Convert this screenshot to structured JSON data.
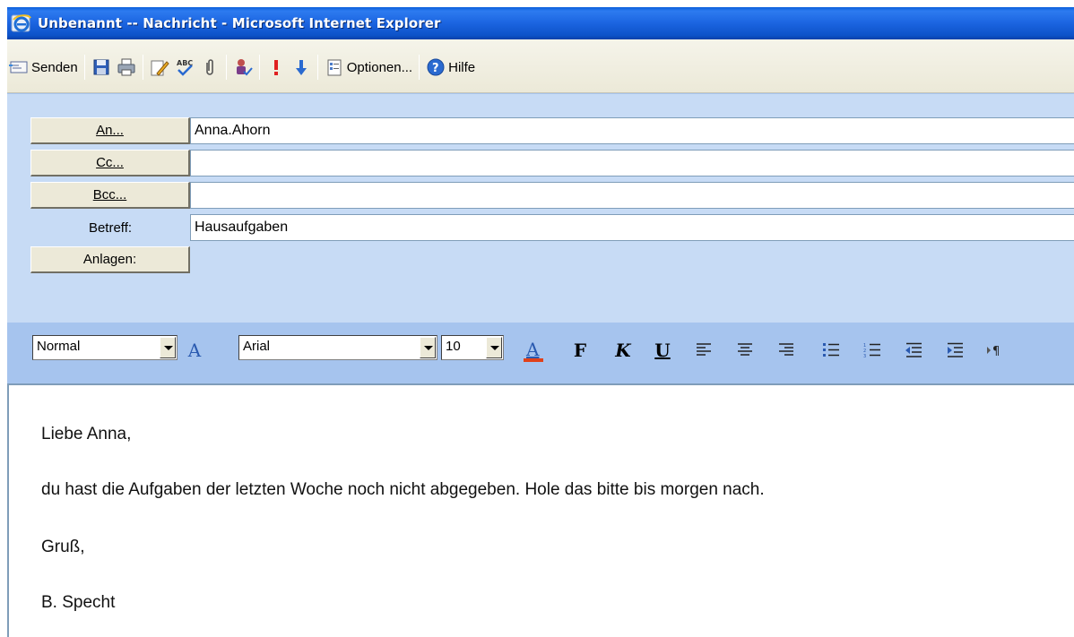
{
  "window": {
    "title": "Unbenannt -- Nachricht - Microsoft Internet Explorer"
  },
  "toolbar": {
    "send_label": "Senden",
    "options_label": "Optionen...",
    "help_label": "Hilfe",
    "icons": [
      "send-icon",
      "save-icon",
      "print-icon",
      "edit-icon",
      "spellcheck-icon",
      "attach-icon",
      "check-names-icon",
      "high-priority-icon",
      "low-priority-icon",
      "options-icon",
      "help-icon"
    ]
  },
  "header": {
    "to_button": "An...",
    "cc_button": "Cc...",
    "bcc_button": "Bcc...",
    "subject_label": "Betreff:",
    "attachments_button": "Anlagen:",
    "to_value": "Anna.Ahorn",
    "cc_value": "",
    "bcc_value": "",
    "subject_value": "Hausaufgaben"
  },
  "format": {
    "style_value": "Normal",
    "font_value": "Arial",
    "size_value": "10",
    "font_color_letter": "A",
    "style_letter": "A",
    "bold_letter": "F",
    "italic_letter": "K",
    "underline_letter": "U",
    "colors": {
      "font_color_bar": "#e0411a"
    }
  },
  "body": {
    "greeting": "Liebe Anna,",
    "text": "du hast die Aufgaben der letzten Woche noch nicht abgegeben. Hole das bitte bis morgen nach.",
    "closing": "Gruß,",
    "signature": "B. Specht"
  }
}
